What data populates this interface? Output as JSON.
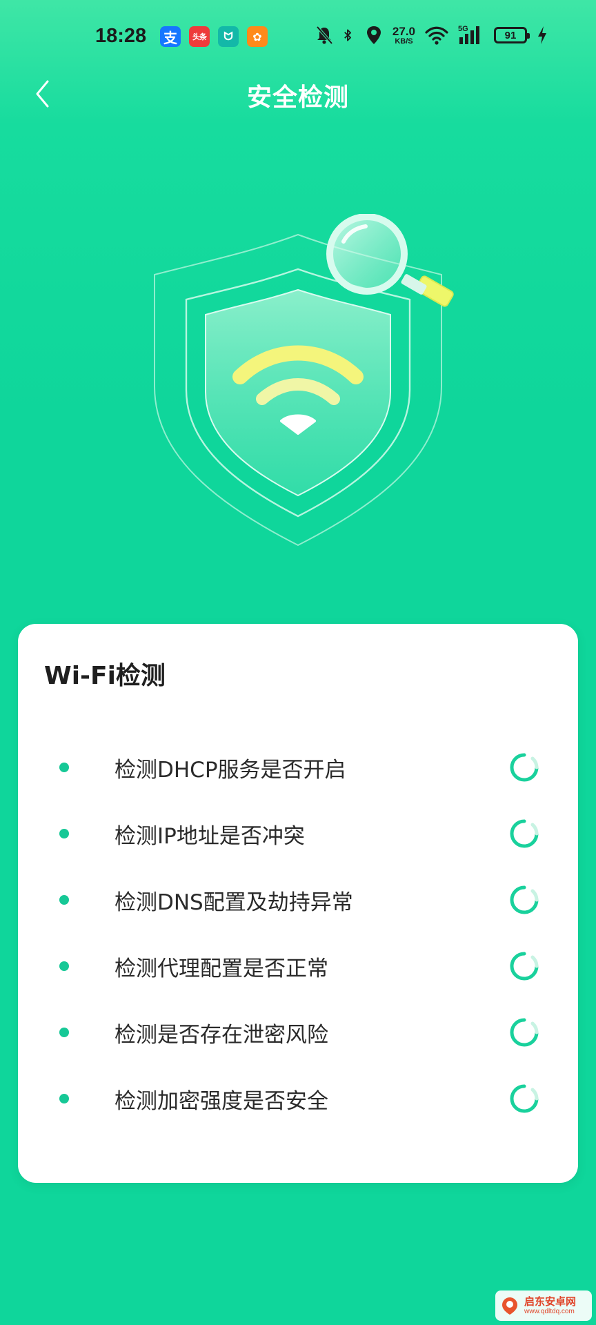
{
  "status_bar": {
    "time": "18:28",
    "apps": [
      {
        "icon": "alipay-icon",
        "glyph": "支"
      },
      {
        "icon": "toutiao-icon",
        "glyph": "头条"
      },
      {
        "icon": "mi-home-icon",
        "glyph": "ᗢ"
      },
      {
        "icon": "game-app-icon",
        "glyph": "✿"
      }
    ],
    "net_speed_value": "27.0",
    "net_speed_unit": "KB/S",
    "network_type": "5G",
    "battery_level": "91",
    "charging": true
  },
  "header": {
    "back_label": "back",
    "title": "安全检测"
  },
  "hero": {
    "illustration": "shield-wifi-magnifier-illustration"
  },
  "card": {
    "title": "Wi-Fi检测",
    "items": [
      {
        "label": "检测DHCP服务是否开启",
        "status": "loading"
      },
      {
        "label": "检测IP地址是否冲突",
        "status": "loading"
      },
      {
        "label": "检测DNS配置及劫持异常",
        "status": "loading"
      },
      {
        "label": "检测代理配置是否正常",
        "status": "loading"
      },
      {
        "label": "检测是否存在泄密风险",
        "status": "loading"
      },
      {
        "label": "检测加密强度是否安全",
        "status": "loading"
      }
    ]
  },
  "watermark": {
    "name": "启东安卓网",
    "url": "www.qdltdq.com"
  },
  "colors": {
    "background": "#0fd69b",
    "accent_dot": "#16c896",
    "card": "#ffffff",
    "wifi_yellow": "#f4f57c"
  }
}
